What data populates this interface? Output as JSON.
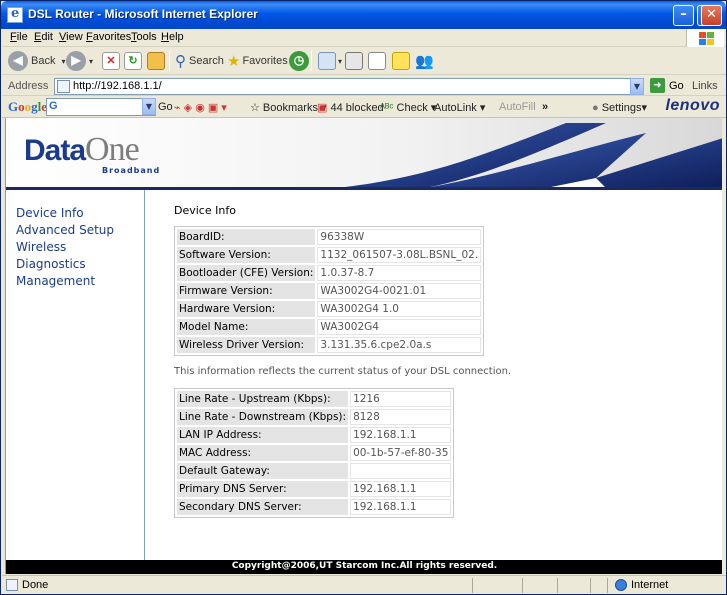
{
  "window": {
    "title": "DSL Router - Microsoft Internet Explorer"
  },
  "menu": [
    "File",
    "Edit",
    "View",
    "Favorites",
    "Tools",
    "Help"
  ],
  "toolbar": {
    "back": "Back",
    "search": "Search",
    "favorites": "Favorites"
  },
  "address": {
    "label": "Address",
    "url": "http://192.168.1.1/",
    "go": "Go",
    "links": "Links"
  },
  "google_bar": {
    "logo": "Google",
    "search_value": "G",
    "go": "Go",
    "bookmarks": "Bookmarks",
    "blocked": "44 blocked",
    "check": "Check",
    "autolink": "AutoLink",
    "autofill": "AutoFill",
    "settings": "Settings",
    "brand": "lenovo"
  },
  "banner": {
    "logo_data": "Data",
    "logo_one": "One",
    "logo_sub": "Broadband"
  },
  "nav": [
    "Device Info",
    "Advanced Setup",
    "Wireless",
    "Diagnostics",
    "Management"
  ],
  "device": {
    "heading": "Device Info",
    "rows": [
      {
        "label": "BoardID:",
        "value": "96338W"
      },
      {
        "label": "Software Version:",
        "value": "1132_061507-3.08L.BSNL_02."
      },
      {
        "label": "Bootloader (CFE) Version:",
        "value": "1.0.37-8.7"
      },
      {
        "label": "Firmware Version:",
        "value": "WA3002G4-0021.01"
      },
      {
        "label": "Hardware Version:",
        "value": "WA3002G4 1.0"
      },
      {
        "label": "Model Name:",
        "value": "WA3002G4"
      },
      {
        "label": "Wireless Driver Version:",
        "value": "3.131.35.6.cpe2.0a.s"
      }
    ],
    "note": "This information reflects the current status of your DSL connection."
  },
  "dsl": {
    "rows": [
      {
        "label": "Line Rate - Upstream (Kbps):",
        "value": "1216"
      },
      {
        "label": "Line Rate - Downstream (Kbps):",
        "value": "8128"
      },
      {
        "label": "LAN IP Address:",
        "value": "192.168.1.1"
      },
      {
        "label": "MAC Address:",
        "value": "00-1b-57-ef-80-35"
      },
      {
        "label": "Default Gateway:",
        "value": ""
      },
      {
        "label": "Primary DNS Server:",
        "value": "192.168.1.1"
      },
      {
        "label": "Secondary DNS Server:",
        "value": "192.168.1.1"
      }
    ]
  },
  "footer": "Copyright@2006,UT Starcom Inc.All rights reserved.",
  "status": {
    "left": "Done",
    "zone": "Internet"
  },
  "colors": {
    "title_blue": "#0054e3",
    "nav_link": "#1a3c8e",
    "banner_blue": "#1b2a5c",
    "footer_bg": "#000000"
  }
}
